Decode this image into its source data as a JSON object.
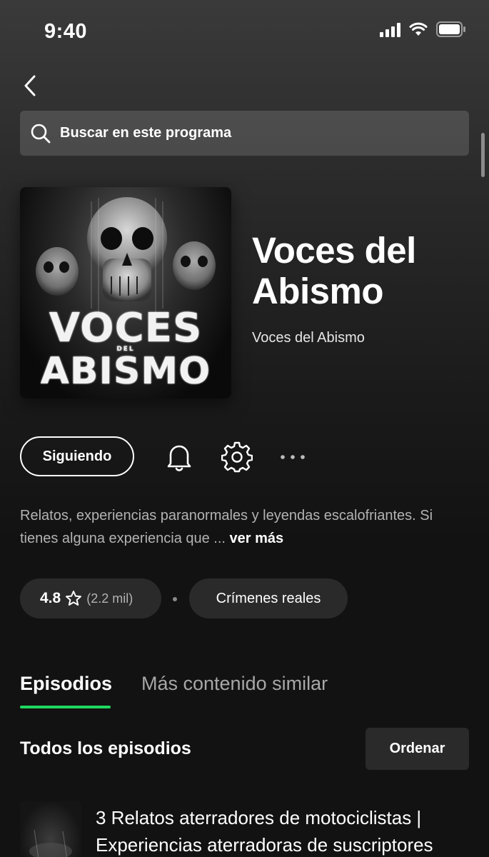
{
  "status_bar": {
    "time": "9:40"
  },
  "search": {
    "placeholder": "Buscar en este programa"
  },
  "show": {
    "title": "Voces del Abismo",
    "author": "Voces del Abismo",
    "cover_text_top": "VOCES",
    "cover_text_small": "DEL",
    "cover_text_bottom": "ABISMO"
  },
  "actions": {
    "follow_label": "Siguiendo"
  },
  "description": {
    "text": "Relatos, experiencias paranormales y leyendas escalofriantes. Si tienes alguna experiencia que ...",
    "more_label": "ver más"
  },
  "rating": {
    "value": "4.8",
    "count": "(2.2 mil)"
  },
  "genre": {
    "label": "Crímenes reales"
  },
  "tabs": [
    {
      "label": "Episodios",
      "active": true
    },
    {
      "label": "Más contenido similar",
      "active": false
    }
  ],
  "episodes_section": {
    "title": "Todos los episodios",
    "sort_label": "Ordenar",
    "items": [
      {
        "title": "3 Relatos aterradores de motociclistas | Experiencias aterradoras de suscriptores"
      }
    ]
  },
  "colors": {
    "accent": "#1ed760",
    "background": "#121212",
    "pill": "#2a2a2a"
  }
}
